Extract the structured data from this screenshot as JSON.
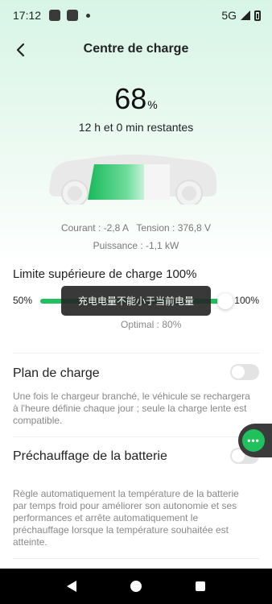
{
  "status_bar": {
    "time": "17:12",
    "network": "5G",
    "icons": [
      "notification-icon",
      "notification-icon",
      "dot-icon",
      "signal-icon",
      "battery-charging-icon"
    ]
  },
  "header": {
    "title": "Centre de charge",
    "back_icon": "chevron-left-icon"
  },
  "charge": {
    "soc_value": "68",
    "soc_unit": "%",
    "remaining": "12 h et 0 min restantes",
    "current": "Courant : -2,8 A",
    "voltage": "Tension : 376,8 V",
    "power": "Puissance : -1,1 kW",
    "battery_fill_fraction": 0.68
  },
  "limit": {
    "title": "Limite supérieure de charge 100%",
    "min_label": "50%",
    "max_label": "100%",
    "value_fraction": 1.0,
    "optimal": "Optimal : 80%"
  },
  "toast": {
    "text": "充电电量不能小于当前电量"
  },
  "plan": {
    "title": "Plan de charge",
    "enabled": false,
    "description": "Une fois le chargeur branché, le véhicule se rechargera à l'heure définie chaque jour ; seule la charge lente est compatible."
  },
  "preheat": {
    "title": "Préchauffage de la batterie",
    "enabled": false,
    "description": "Règle automatiquement la température de la batterie par temps froid pour améliorer son autonomie et ses performances et arrête automatiquement le préchauffage lorsque la température souhaitée est atteinte."
  },
  "float_button": {
    "label": "•••"
  },
  "colors": {
    "accent": "#1fc15c",
    "toast_bg": "#2a2a2a"
  }
}
